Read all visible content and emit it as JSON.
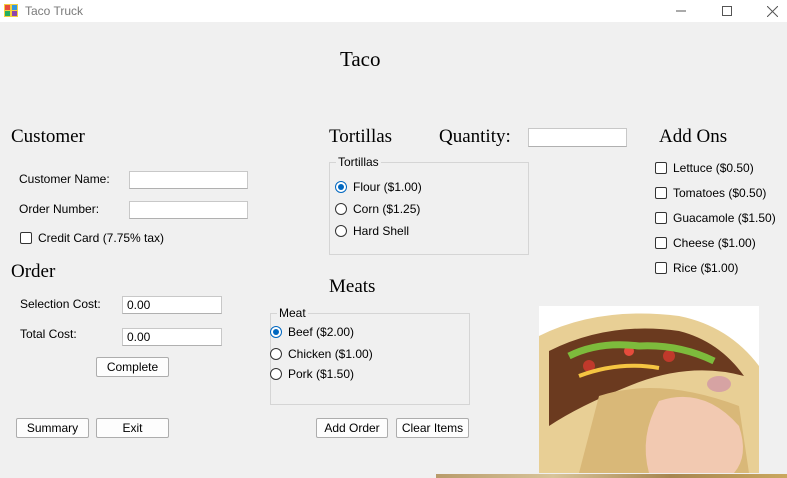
{
  "window": {
    "title": "Taco Truck",
    "minimize_icon": "minimize-icon",
    "maximize_icon": "maximize-icon",
    "close_icon": "close-icon"
  },
  "header": {
    "title": "Taco"
  },
  "customer": {
    "heading": "Customer",
    "name_label": "Customer Name:",
    "name_value": "",
    "order_number_label": "Order Number:",
    "order_number_value": "",
    "credit_card_label": "Credit Card (7.75% tax)"
  },
  "order": {
    "heading": "Order",
    "selection_cost_label": "Selection Cost:",
    "selection_cost_value": "0.00",
    "total_cost_label": "Total Cost:",
    "total_cost_value": "0.00",
    "complete_label": "Complete"
  },
  "tortillas": {
    "heading": "Tortillas",
    "group_title": "Tortillas",
    "options": [
      "Flour ($1.00)",
      "Corn ($1.25)",
      "Hard Shell"
    ],
    "selected": "Flour ($1.00)"
  },
  "quantity": {
    "label": "Quantity:",
    "value": ""
  },
  "addons": {
    "heading": "Add Ons",
    "items": [
      "Lettuce ($0.50)",
      "Tomatoes ($0.50)",
      "Guacamole ($1.50)",
      "Cheese ($1.00)",
      "Rice ($1.00)"
    ]
  },
  "meats": {
    "heading": "Meats",
    "group_title": "Meat",
    "options": [
      "Beef ($2.00)",
      "Chicken ($1.00)",
      "Pork ($1.50)"
    ],
    "selected": "Beef ($2.00)"
  },
  "buttons": {
    "summary": "Summary",
    "exit": "Exit",
    "add_order": "Add Order",
    "clear_items": "Clear Items"
  },
  "colors": {
    "radio_accent": "#0067c0",
    "background": "#f0f0f0"
  }
}
